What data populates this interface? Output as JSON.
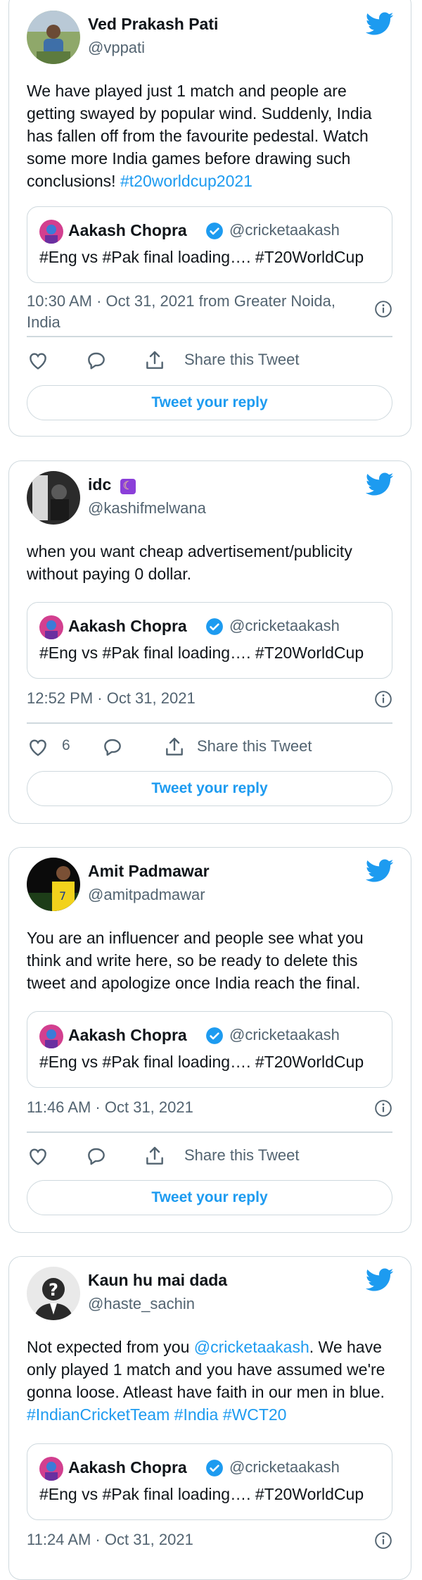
{
  "tweets": [
    {
      "author_name": "Ved Prakash Pati",
      "author_handle": "@vppati",
      "body_parts": [
        "We have played just 1 match and people are getting swayed by popular wind. Suddenly, India has fallen off from the favourite pedestal. Watch some more India games before drawing such conclusions! "
      ],
      "hashtags": [
        "#t20worldcup2021"
      ],
      "timestamp": "10:30 AM · Oct 31, 2021 from Greater Noida, India",
      "likes": "",
      "share_label": "Share this Tweet",
      "reply_label": "Tweet your reply"
    },
    {
      "author_name": "idc",
      "author_emoji": "☾",
      "author_handle": "@kashifmelwana",
      "body": "when you want cheap advertisement/publicity without paying 0 dollar.",
      "timestamp": "12:52 PM · Oct 31, 2021",
      "likes": "6",
      "share_label": "Share this Tweet",
      "reply_label": "Tweet your reply"
    },
    {
      "author_name": "Amit Padmawar",
      "author_handle": "@amitpadmawar",
      "body": "You are an influencer and people see what you think and write here, so be ready to delete this tweet and apologize once India reach the final.",
      "timestamp": "11:46 AM · Oct 31, 2021",
      "likes": "",
      "share_label": "Share this Tweet",
      "reply_label": "Tweet your reply"
    },
    {
      "author_name": "Kaun hu mai dada",
      "author_handle": "@haste_sachin",
      "body_parts": [
        "Not expected from you ",
        "@cricketaakash",
        ". We have only played 1 match and you have assumed we're gonna loose. Atleast have faith in our men in blue. ",
        "#IndianCricketTeam #India #WCT20"
      ],
      "timestamp": "11:24 AM · Oct 31, 2021"
    }
  ],
  "quoted_tweet": {
    "author_name": "Aakash Chopra",
    "author_handle": "@cricketaakash",
    "text": "#Eng vs #Pak final loading…. #T20WorldCup"
  },
  "colors": {
    "accent": "#1d9bf0",
    "text": "#0f1419",
    "secondary": "#536471",
    "border": "#cfd9de",
    "verified": "#1d9bf0",
    "moon_emoji": "#8b3fd9"
  },
  "icons": [
    "twitter-bird-icon",
    "verified-badge-icon",
    "info-icon",
    "like-heart-icon",
    "reply-bubble-icon",
    "share-icon"
  ]
}
